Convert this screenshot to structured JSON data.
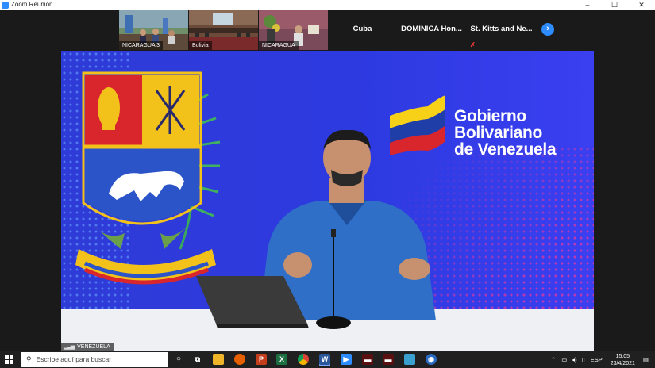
{
  "window": {
    "title": "Zoom Reunión",
    "controls": [
      "–",
      "☐",
      "✕"
    ]
  },
  "thumbnails": [
    {
      "label": "NICARAGUA 3"
    },
    {
      "label": "Bolivia"
    },
    {
      "label": "NICARAGUA"
    }
  ],
  "participants": [
    {
      "name": "Cuba"
    },
    {
      "name": "DOMINICA  Hon..."
    },
    {
      "name": "St. Kitts and Ne..."
    }
  ],
  "next_label": "›",
  "main": {
    "logo_lines": [
      "Gobierno",
      "Bolivariano",
      "de Venezuela"
    ],
    "speaker_label": "VENEZUELA"
  },
  "taskbar": {
    "search_placeholder": "Escribe aquí para buscar",
    "lang": "ESP",
    "time": "15:05",
    "date": "23/4/2021"
  },
  "colors": {
    "zoom_blue": "#2d8cff",
    "backdrop_blue": "#2f3bd6",
    "muted_red": "#e53935"
  }
}
